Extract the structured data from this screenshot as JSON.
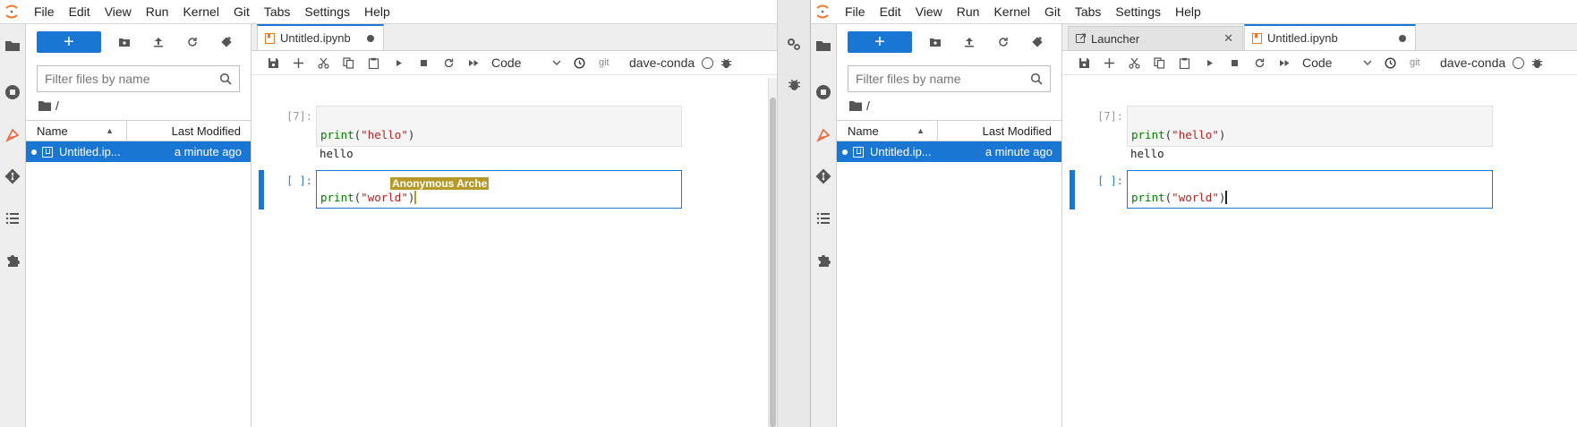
{
  "menus": [
    "File",
    "Edit",
    "View",
    "Run",
    "Kernel",
    "Git",
    "Tabs",
    "Settings",
    "Help"
  ],
  "filebrowser": {
    "new_label": "+",
    "search_placeholder": "Filter files by name",
    "breadcrumb": "/",
    "col_name": "Name",
    "col_modified": "Last Modified",
    "files": [
      {
        "name": "Untitled.ip...",
        "modified": "a minute ago"
      }
    ]
  },
  "left": {
    "tabs": [
      {
        "label": "Untitled.ipynb",
        "type": "notebook",
        "status": "dirty-dot"
      }
    ],
    "cell_type": "Code",
    "git_label": "git",
    "kernel": "dave-conda",
    "cells": [
      {
        "prompt": "[7]:",
        "code_kw": "print",
        "code_str": "\"hello\"",
        "output": "hello"
      },
      {
        "prompt": "[ ]:",
        "code_kw": "print",
        "code_str": "\"world\"",
        "output": ""
      }
    ],
    "collaborator": "Anonymous Arche"
  },
  "right": {
    "tabs": [
      {
        "label": "Launcher",
        "type": "launcher",
        "status": "close"
      },
      {
        "label": "Untitled.ipynb",
        "type": "notebook",
        "status": "dirty-dot"
      }
    ],
    "cell_type": "Code",
    "git_label": "git",
    "kernel": "dave-conda",
    "cells": [
      {
        "prompt": "[7]:",
        "code_kw": "print",
        "code_str": "\"hello\"",
        "output": "hello"
      },
      {
        "prompt": "[ ]:",
        "code_kw": "print",
        "code_str": "\"world\"",
        "output": ""
      }
    ]
  },
  "colors": {
    "accent": "#1976d2",
    "collab": "#b59a2a",
    "jupyter_orange": "#f37626"
  },
  "icons": [
    "folder-icon",
    "running-icon",
    "extension-icon",
    "git-icon",
    "toc-icon",
    "puzzle-icon",
    "settings-icon",
    "debugger-icon"
  ]
}
